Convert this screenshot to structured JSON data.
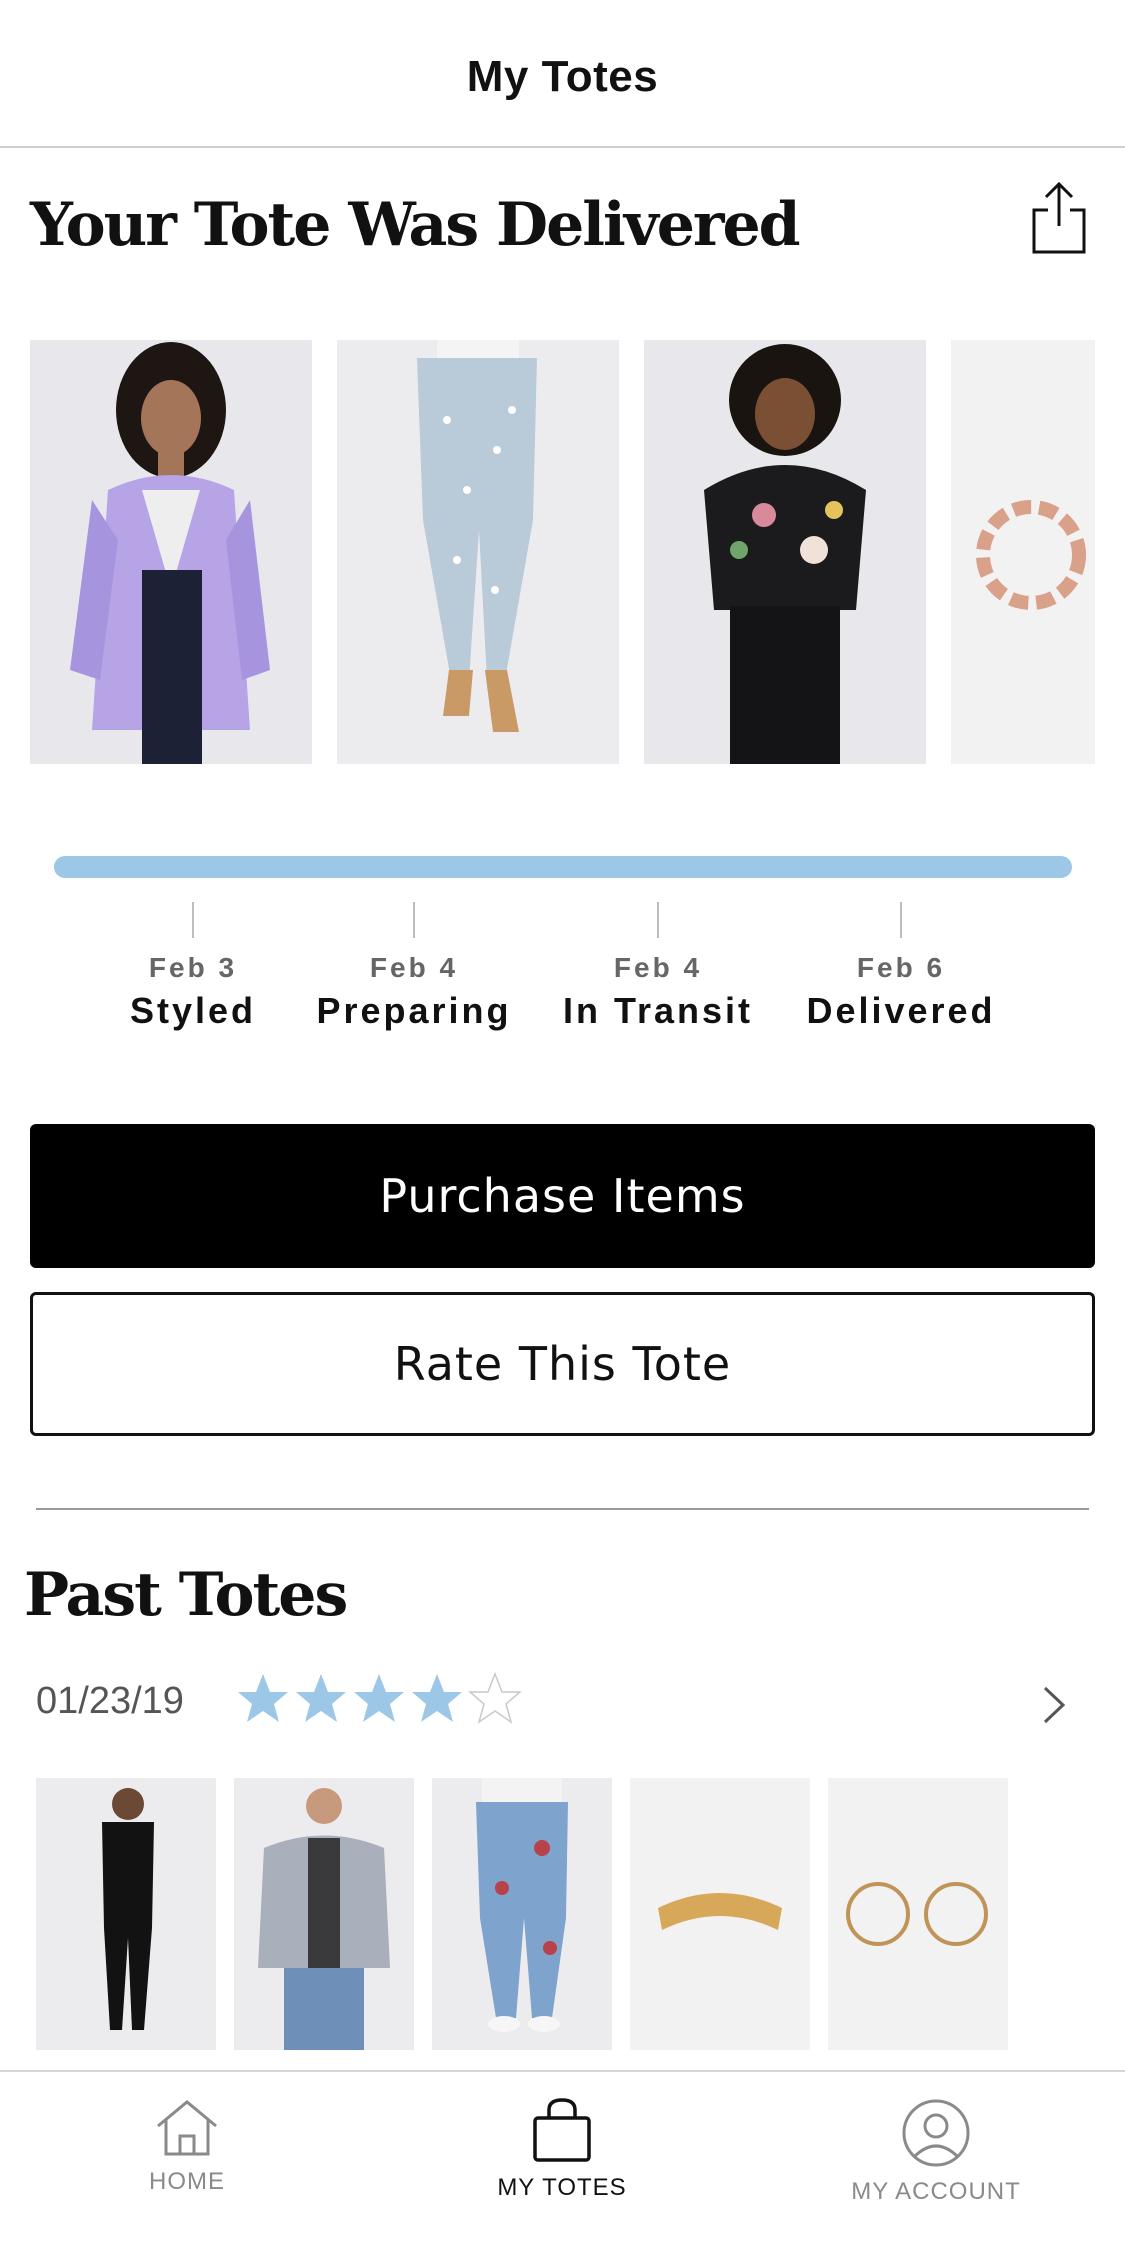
{
  "header": {
    "title": "My Totes"
  },
  "current_tote": {
    "heading": "Your Tote Was Delivered",
    "products": [
      {
        "name": "lavender-blazer"
      },
      {
        "name": "floral-jeans"
      },
      {
        "name": "floral-sweater"
      },
      {
        "name": "tortoise-hoop-earrings"
      }
    ],
    "progress": 1.0,
    "steps": [
      {
        "date": "Feb 3",
        "label": "Styled"
      },
      {
        "date": "Feb 4",
        "label": "Preparing"
      },
      {
        "date": "Feb 4",
        "label": "In Transit"
      },
      {
        "date": "Feb 6",
        "label": "Delivered"
      }
    ],
    "purchase_label": "Purchase Items",
    "rate_label": "Rate This Tote"
  },
  "past_totes": {
    "heading": "Past Totes",
    "items": [
      {
        "date": "01/23/19",
        "rating": 4,
        "max_rating": 5
      }
    ]
  },
  "tabbar": {
    "tabs": [
      {
        "label": "HOME",
        "active": false
      },
      {
        "label": "MY TOTES",
        "active": true
      },
      {
        "label": "MY ACCOUNT",
        "active": false
      }
    ]
  },
  "colors": {
    "accent": "#9cc7e6",
    "star": "#9cc7e6"
  }
}
